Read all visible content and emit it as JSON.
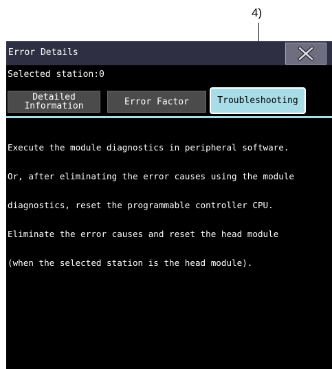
{
  "callout": {
    "label": "4)"
  },
  "window": {
    "title": "Error Details",
    "station_text": "Selected station:0",
    "tabs": [
      {
        "label_line1": "Detailed",
        "label_line2": "Information",
        "selected": false
      },
      {
        "label": "Error Factor",
        "selected": false
      },
      {
        "label": "Troubleshooting",
        "selected": true
      }
    ],
    "body_lines": [
      "Execute the module diagnostics in peripheral software.",
      "Or, after eliminating the error causes using the module",
      "diagnostics, reset the programmable controller CPU.",
      "Eliminate the error causes and reset the head module",
      "(when the selected station is the head module)."
    ]
  },
  "colors": {
    "titlebar": "#2f2f44",
    "selected_tab": "#a8dde8",
    "close_button": "#6e6e80"
  },
  "icons": {
    "close": "close-x-icon"
  }
}
